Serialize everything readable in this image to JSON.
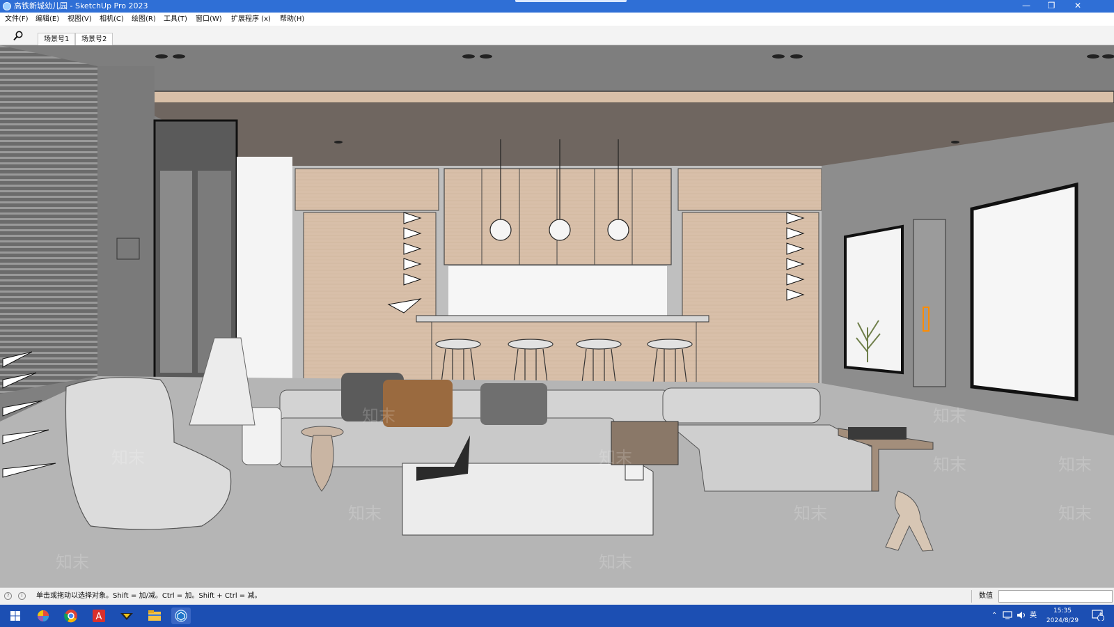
{
  "window": {
    "title": "高铁新城幼儿园 - SketchUp Pro 2023",
    "app_icon": "sketchup-icon",
    "controls": {
      "minimize": "—",
      "maximize": "❐",
      "close": "✕"
    }
  },
  "menu": {
    "items": [
      {
        "label": "文件(F)"
      },
      {
        "label": "编辑(E)"
      },
      {
        "label": "视图(V)"
      },
      {
        "label": "相机(C)"
      },
      {
        "label": "绘图(R)"
      },
      {
        "label": "工具(T)"
      },
      {
        "label": "窗口(W)"
      },
      {
        "label": "扩展程序 (x)"
      },
      {
        "label": "帮助(H)"
      }
    ]
  },
  "toolbar": {
    "search_icon": "search-icon"
  },
  "scenes": {
    "tabs": [
      {
        "label": "场景号1",
        "active": false
      },
      {
        "label": "场景号2",
        "active": true
      }
    ]
  },
  "viewport": {
    "watermark": "知末",
    "scene": "living room with open kitchen"
  },
  "status": {
    "hint": "单击或拖动以选择对象。Shift = 加/减。Ctrl = 加。Shift + Ctrl = 减。",
    "measurements_label": "数值",
    "measurements_value": ""
  },
  "taskbar": {
    "apps": [
      "windows-start-icon",
      "color-app-icon",
      "chrome-icon",
      "acrobat-icon",
      "app-icon",
      "file-explorer-icon",
      "sketchup-taskbar-icon"
    ],
    "tray": {
      "ime": "英",
      "time": "15:35",
      "date": "2024/8/29",
      "notifications": "6"
    }
  }
}
